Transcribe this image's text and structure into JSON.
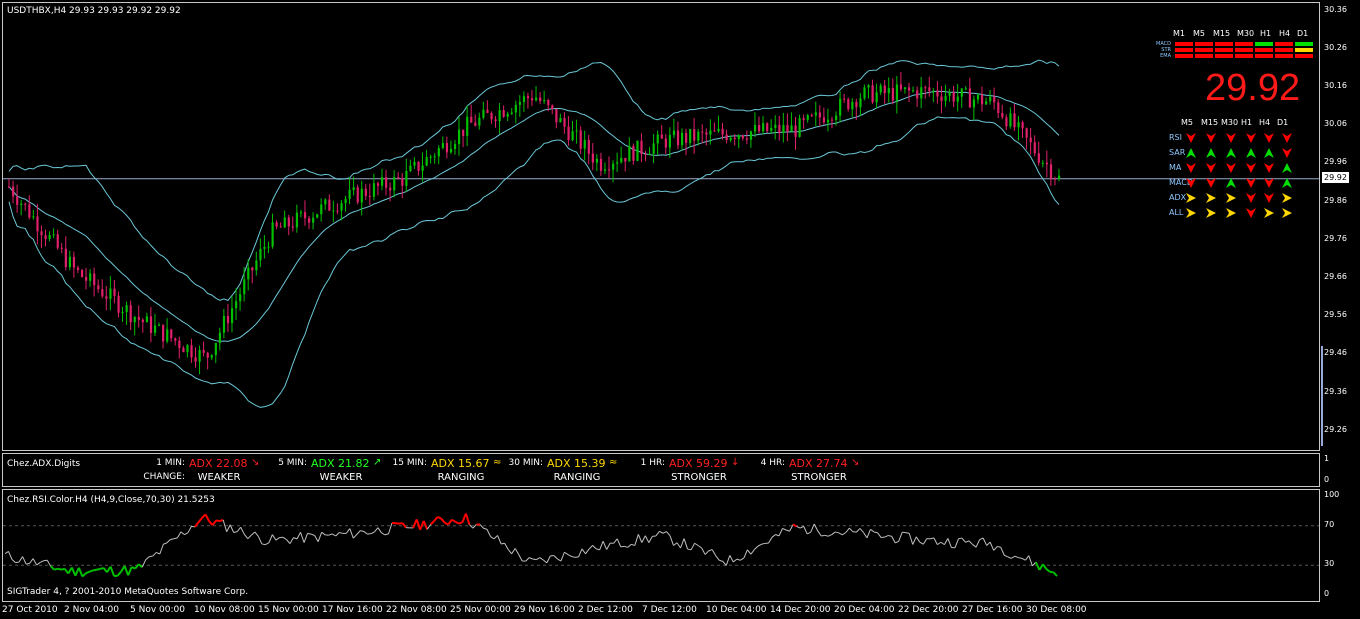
{
  "main": {
    "title": "USDTHBX,H4  29.93 29.93 29.92 29.92",
    "price_axis": [
      "30.36",
      "30.26",
      "30.16",
      "30.06",
      "29.96",
      "29.86",
      "29.76",
      "29.66",
      "29.56",
      "29.46",
      "29.36",
      "29.26"
    ],
    "current_price_label": "29.92",
    "big_price": "29.92",
    "panel": {
      "top_timeframes": [
        "M1",
        "M5",
        "M15",
        "M30",
        "H1",
        "H4",
        "D1"
      ],
      "bar_rows": [
        "MACD",
        "STR",
        "EMA"
      ],
      "bottom_timeframes": [
        "M5",
        "M15",
        "M30",
        "H1",
        "H4",
        "D1"
      ],
      "rows": [
        {
          "label": "RSI",
          "arrows": [
            "dr",
            "dr",
            "dr",
            "dr",
            "dr",
            "dr"
          ]
        },
        {
          "label": "SAR",
          "arrows": [
            "ug",
            "ug",
            "ug",
            "ug",
            "ug",
            "dr"
          ]
        },
        {
          "label": "MA",
          "arrows": [
            "dr",
            "dr",
            "dr",
            "dr",
            "dr",
            "ug"
          ]
        },
        {
          "label": "MACD",
          "arrows": [
            "dr",
            "dr",
            "ug",
            "dr",
            "dr",
            "ug"
          ]
        },
        {
          "label": "ADX",
          "arrows": [
            "ry",
            "ry",
            "ry",
            "dr",
            "dr",
            "ry"
          ]
        },
        {
          "label": "ALL",
          "arrows": [
            "ry",
            "ry",
            "ry",
            "dr",
            "ry",
            "ry"
          ]
        }
      ],
      "colors": {
        "red": "#ff0000",
        "green": "#00e000",
        "yellow": "#ffd700",
        "label": "#8ec8ff"
      }
    }
  },
  "adx": {
    "title": "Chez.ADX.Digits",
    "change_label": "CHANGE:",
    "axis": [
      "1",
      "0"
    ],
    "items": [
      {
        "tf": "1 MIN:",
        "value": "ADX 22.08",
        "arrow": "↘",
        "color": "#ff2020",
        "status": "WEAKER"
      },
      {
        "tf": "5 MIN:",
        "value": "ADX 21.82",
        "arrow": "↗",
        "color": "#20ff20",
        "status": "WEAKER"
      },
      {
        "tf": "15 MIN:",
        "value": "ADX 15.67",
        "arrow": "≈",
        "color": "#ffd700",
        "status": "RANGING"
      },
      {
        "tf": "30 MIN:",
        "value": "ADX 15.39",
        "arrow": "≈",
        "color": "#ffd700",
        "status": "RANGING"
      },
      {
        "tf": "1 HR:",
        "value": "ADX 59.29",
        "arrow": "↓",
        "color": "#ff2020",
        "status": "STRONGER"
      },
      {
        "tf": "4 HR:",
        "value": "ADX 27.74",
        "arrow": "↘",
        "color": "#ff2020",
        "status": "STRONGER"
      }
    ]
  },
  "rsi": {
    "title": "Chez.RSI.Color.H4 (H4,9,Close,70,30) 21.5253",
    "axis": [
      "100",
      "70",
      "30",
      "0"
    ],
    "copyright": "SIGTrader 4, ? 2001-2010 MetaQuotes Software Corp.",
    "colors": {
      "overbought": "#ff0000",
      "oversold": "#00c000",
      "neutral": "#c0c0c0"
    }
  },
  "time_axis": [
    "27 Oct 2010",
    "2 Nov 04:00",
    "5 Nov 00:00",
    "10 Nov 08:00",
    "15 Nov 00:00",
    "17 Nov 16:00",
    "22 Nov 08:00",
    "25 Nov 00:00",
    "29 Nov 16:00",
    "2 Dec 12:00",
    "7 Dec 12:00",
    "10 Dec 04:00",
    "14 Dec 20:00",
    "20 Dec 04:00",
    "22 Dec 20:00",
    "27 Dec 16:00",
    "30 Dec 08:00"
  ],
  "chart_data": {
    "type": "candlestick",
    "symbol": "USDTHBX",
    "timeframe": "H4",
    "ylim": [
      29.21,
      30.38
    ],
    "current_price": 29.92,
    "close_path": [
      [
        "27 Oct 2010",
        29.9
      ],
      [
        "2 Nov 04:00",
        29.68
      ],
      [
        "5 Nov 00:00",
        29.55
      ],
      [
        "10 Nov 08:00",
        29.45
      ],
      [
        "15 Nov 00:00",
        29.78
      ],
      [
        "17 Nov 16:00",
        29.86
      ],
      [
        "22 Nov 08:00",
        29.92
      ],
      [
        "25 Nov 00:00",
        30.06
      ],
      [
        "29 Nov 16:00",
        30.14
      ],
      [
        "2 Dec 12:00",
        29.96
      ],
      [
        "7 Dec 12:00",
        30.02
      ],
      [
        "10 Dec 04:00",
        30.04
      ],
      [
        "14 Dec 20:00",
        30.05
      ],
      [
        "20 Dec 04:00",
        30.14
      ],
      [
        "22 Dec 20:00",
        30.15
      ],
      [
        "27 Dec 16:00",
        30.12
      ],
      [
        "30 Dec 08:00",
        29.92
      ]
    ],
    "rsi_path": [
      [
        "27 Oct 2010",
        40
      ],
      [
        "2 Nov 04:00",
        24
      ],
      [
        "5 Nov 00:00",
        25
      ],
      [
        "10 Nov 08:00",
        78
      ],
      [
        "15 Nov 00:00",
        55
      ],
      [
        "17 Nov 16:00",
        60
      ],
      [
        "22 Nov 08:00",
        68
      ],
      [
        "25 Nov 00:00",
        78
      ],
      [
        "29 Nov 16:00",
        32
      ],
      [
        "2 Dec 12:00",
        48
      ],
      [
        "7 Dec 12:00",
        60
      ],
      [
        "10 Dec 04:00",
        34
      ],
      [
        "14 Dec 20:00",
        68
      ],
      [
        "20 Dec 04:00",
        62
      ],
      [
        "22 Dec 20:00",
        55
      ],
      [
        "27 Dec 16:00",
        52
      ],
      [
        "30 Dec 08:00",
        21.53
      ]
    ]
  }
}
